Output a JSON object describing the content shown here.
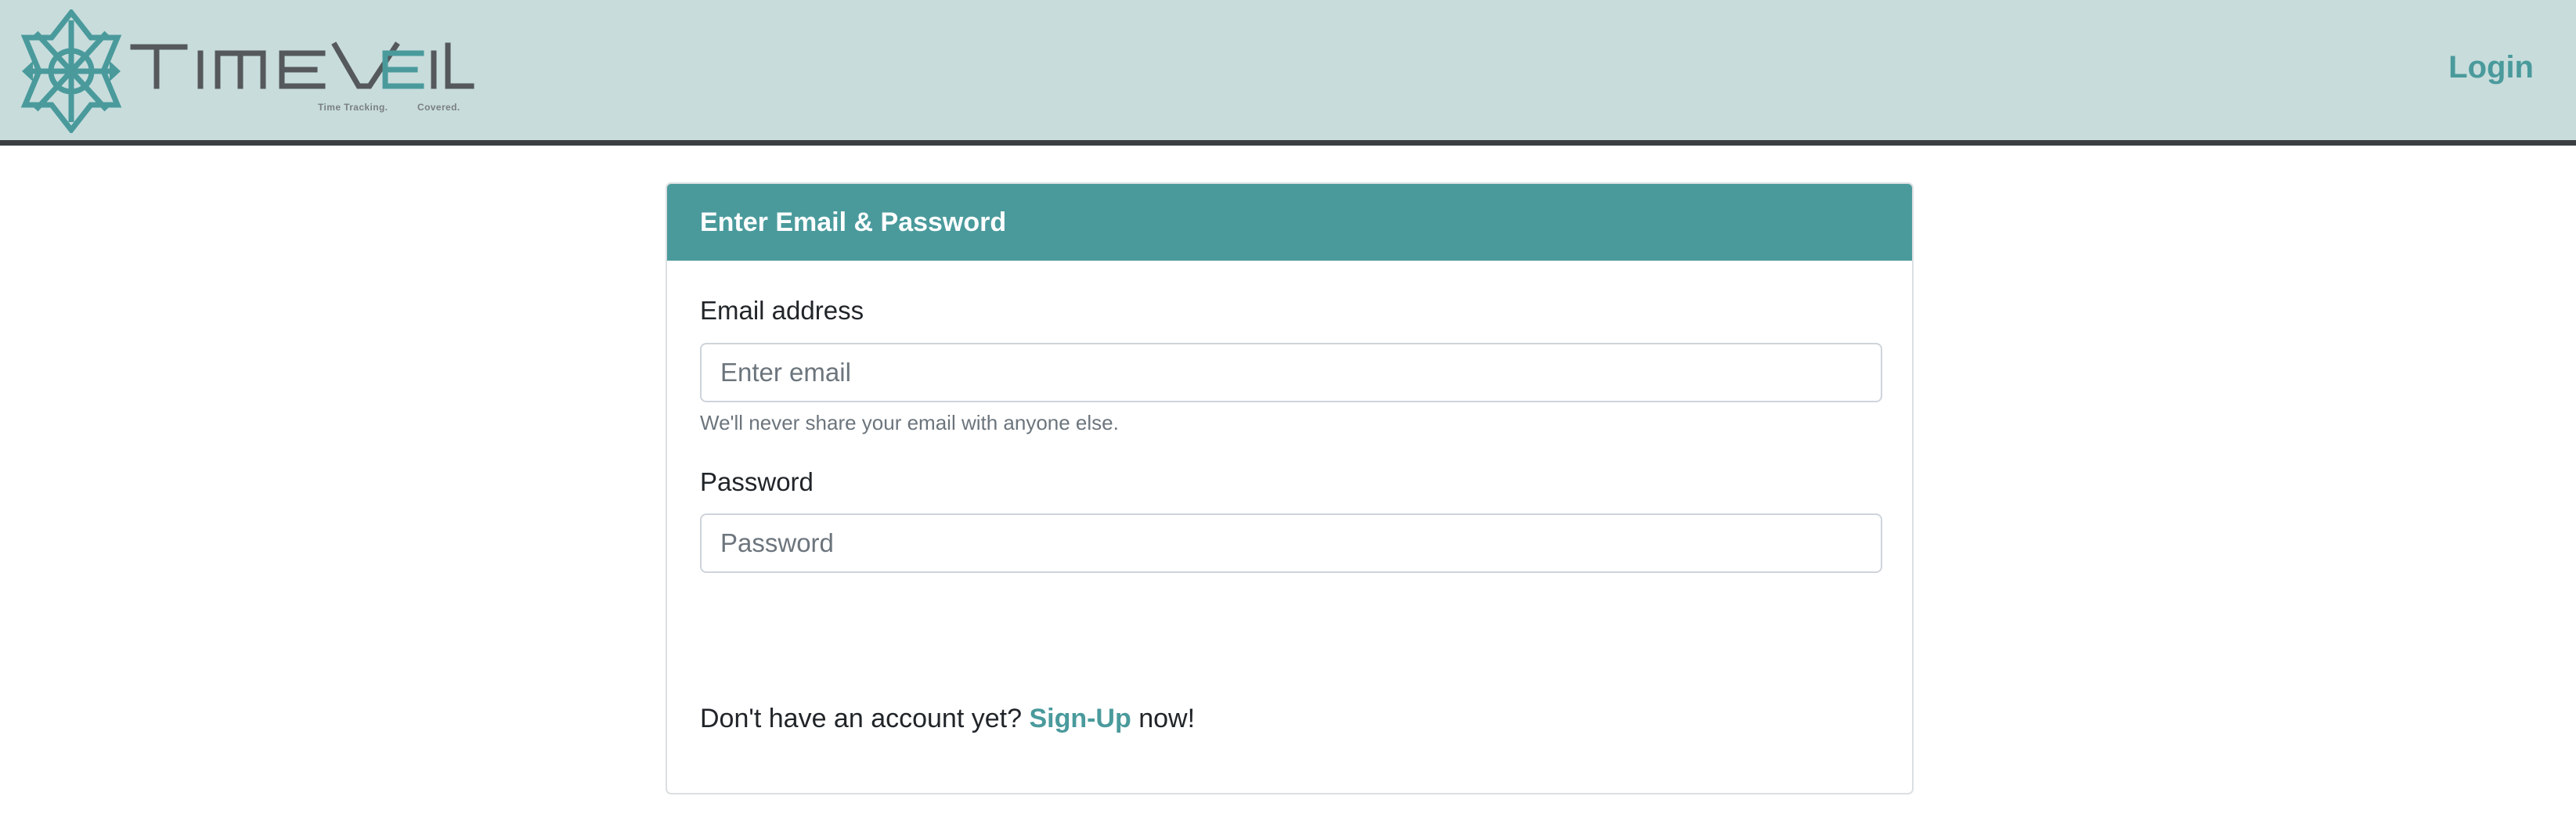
{
  "brand": {
    "wordmark": "TimeVeil",
    "tagline_part1": "Time Tracking.",
    "tagline_part2": "Covered.",
    "accent_color": "#4a9a9c",
    "header_bg": "#c8dcdc"
  },
  "nav": {
    "login_label": "Login"
  },
  "card": {
    "title": "Enter Email & Password",
    "email": {
      "label": "Email address",
      "placeholder": "Enter email",
      "value": "",
      "help": "We'll never share your email with anyone else."
    },
    "password": {
      "label": "Password",
      "placeholder": "Password",
      "value": ""
    },
    "signup": {
      "prefix": "Don't have an account yet?",
      "link_label": "Sign-Up",
      "suffix": "now!"
    }
  }
}
